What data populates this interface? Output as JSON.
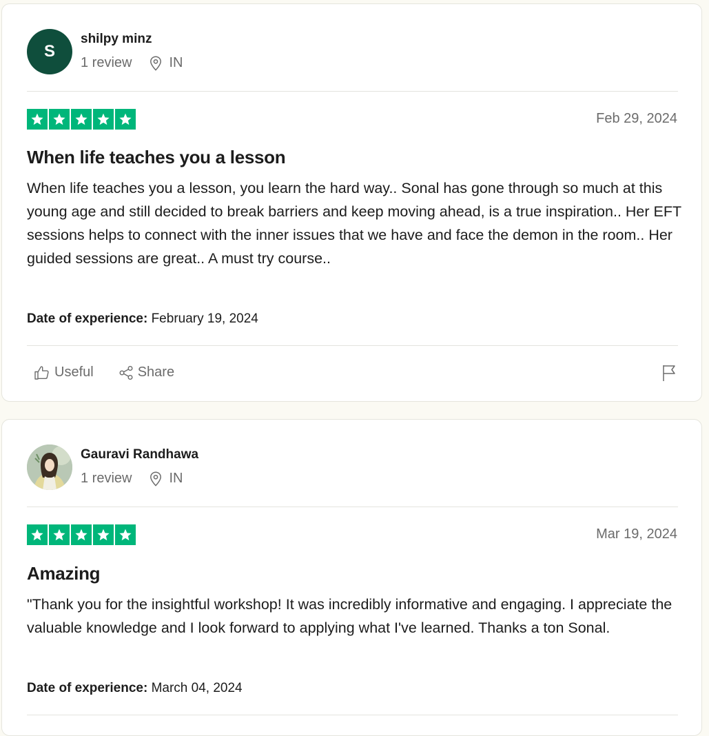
{
  "colors": {
    "star_green": "#00b67a",
    "avatar_initial_bg": "#0f4e3c"
  },
  "reviews": [
    {
      "avatar_initial": "S",
      "reviewer_name": "shilpy minz",
      "review_count": "1 review",
      "country": "IN",
      "rating": 5,
      "date": "Feb 29, 2024",
      "title": "When life teaches you a lesson",
      "body": "When life teaches you a lesson, you learn the hard way.. Sonal has gone through so much at this young age and still decided to break barriers and keep moving ahead, is a true inspiration.. Her EFT sessions helps to connect with the inner issues that we have and face the demon in the room.. Her guided sessions are great.. A must try course..",
      "experience_label": "Date of experience:",
      "experience_date": "February 19, 2024",
      "useful_label": "Useful",
      "share_label": "Share"
    },
    {
      "reviewer_name": "Gauravi Randhawa",
      "review_count": "1 review",
      "country": "IN",
      "rating": 5,
      "date": "Mar 19, 2024",
      "title": "Amazing",
      "body": "\"Thank you for the insightful workshop! It was incredibly informative and engaging. I appreciate the valuable knowledge and I look forward to applying what I've learned. Thanks a ton Sonal.",
      "experience_label": "Date of experience:",
      "experience_date": "March 04, 2024"
    }
  ]
}
